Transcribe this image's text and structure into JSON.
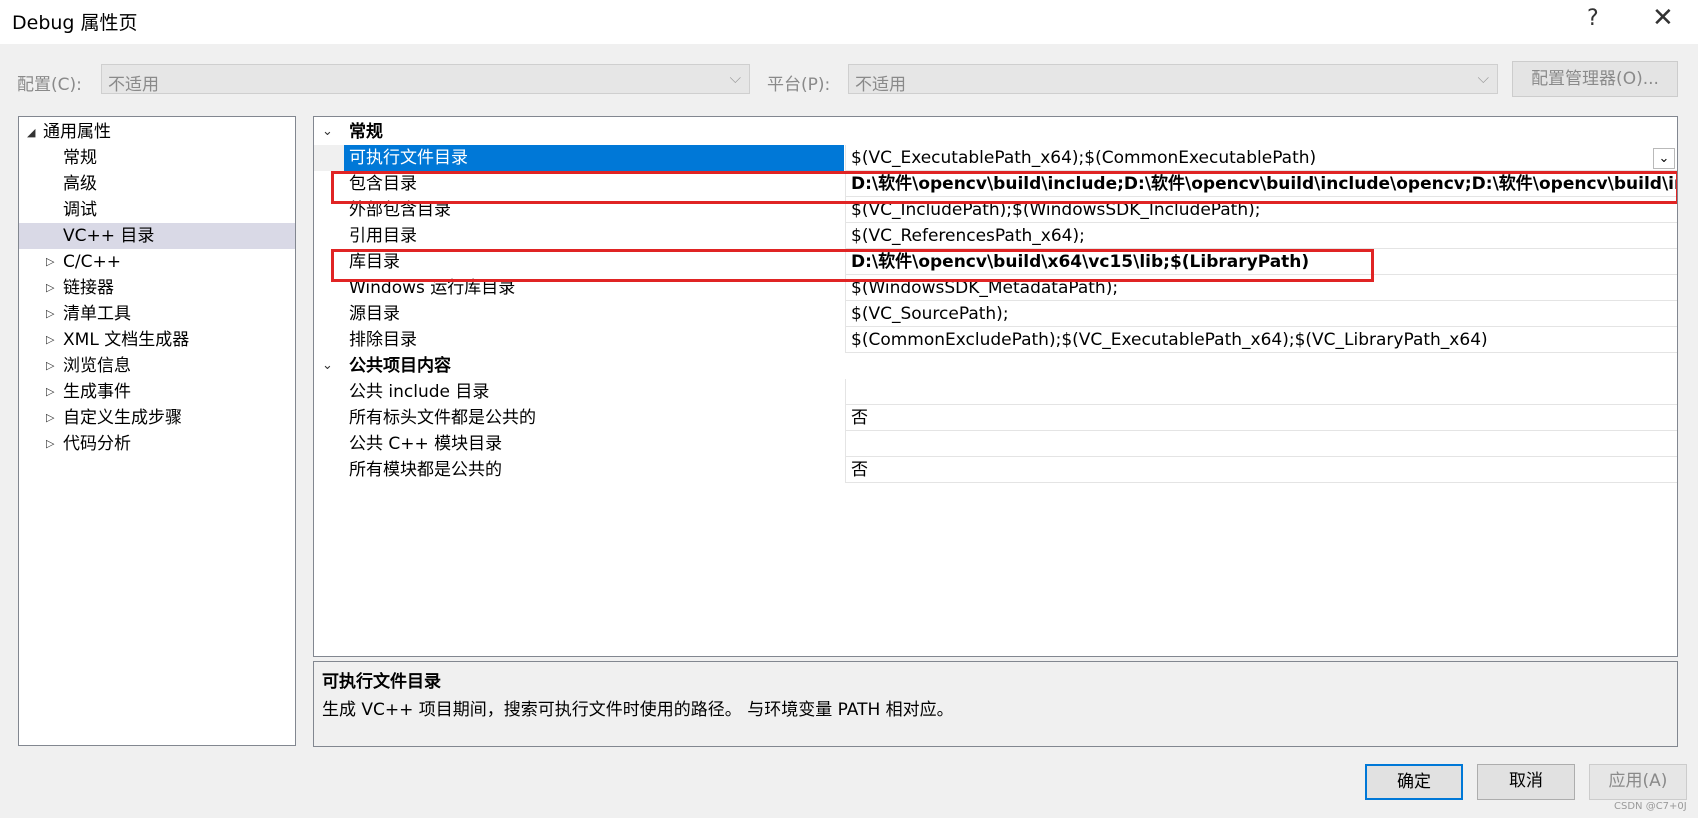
{
  "window": {
    "title": "Debug 属性页",
    "help": "?",
    "close": "✕"
  },
  "config": {
    "config_label": "配置(C):",
    "config_value": "不适用",
    "platform_label": "平台(P):",
    "platform_value": "不适用",
    "manager_button": "配置管理器(O)..."
  },
  "tree": {
    "root": "通用属性",
    "children": [
      "常规",
      "高级",
      "调试",
      "VC++ 目录"
    ],
    "groups": [
      "C/C++",
      "链接器",
      "清单工具",
      "XML 文档生成器",
      "浏览信息",
      "生成事件",
      "自定义生成步骤",
      "代码分析"
    ]
  },
  "grid": {
    "sections": [
      {
        "name": "常规",
        "rows": [
          {
            "name": "可执行文件目录",
            "value": "$(VC_ExecutablePath_x64);$(CommonExecutablePath)"
          },
          {
            "name": "包含目录",
            "value": "D:\\软件\\opencv\\build\\include;D:\\软件\\opencv\\build\\include\\opencv;D:\\软件\\opencv\\build\\inc"
          },
          {
            "name": "外部包含目录",
            "value": "$(VC_IncludePath);$(WindowsSDK_IncludePath);"
          },
          {
            "name": "引用目录",
            "value": "$(VC_ReferencesPath_x64);"
          },
          {
            "name": "库目录",
            "value": "D:\\软件\\opencv\\build\\x64\\vc15\\lib;$(LibraryPath)"
          },
          {
            "name": "Windows 运行库目录",
            "value": "$(WindowsSDK_MetadataPath);"
          },
          {
            "name": "源目录",
            "value": "$(VC_SourcePath);"
          },
          {
            "name": "排除目录",
            "value": "$(CommonExcludePath);$(VC_ExecutablePath_x64);$(VC_LibraryPath_x64)"
          }
        ]
      },
      {
        "name": "公共项目内容",
        "rows": [
          {
            "name": "公共 include 目录",
            "value": ""
          },
          {
            "name": "所有标头文件都是公共的",
            "value": "否"
          },
          {
            "name": "公共 C++ 模块目录",
            "value": ""
          },
          {
            "name": "所有模块都是公共的",
            "value": "否"
          }
        ]
      }
    ]
  },
  "description": {
    "title": "可执行文件目录",
    "text": "生成 VC++ 项目期间，搜索可执行文件时使用的路径。 与环境变量 PATH 相对应。"
  },
  "buttons": {
    "ok": "确定",
    "cancel": "取消",
    "apply": "应用(A)"
  },
  "watermark": "CSDN @C7+0J",
  "colors": {
    "selection": "#0078d7",
    "highlight_box": "#e02424"
  }
}
